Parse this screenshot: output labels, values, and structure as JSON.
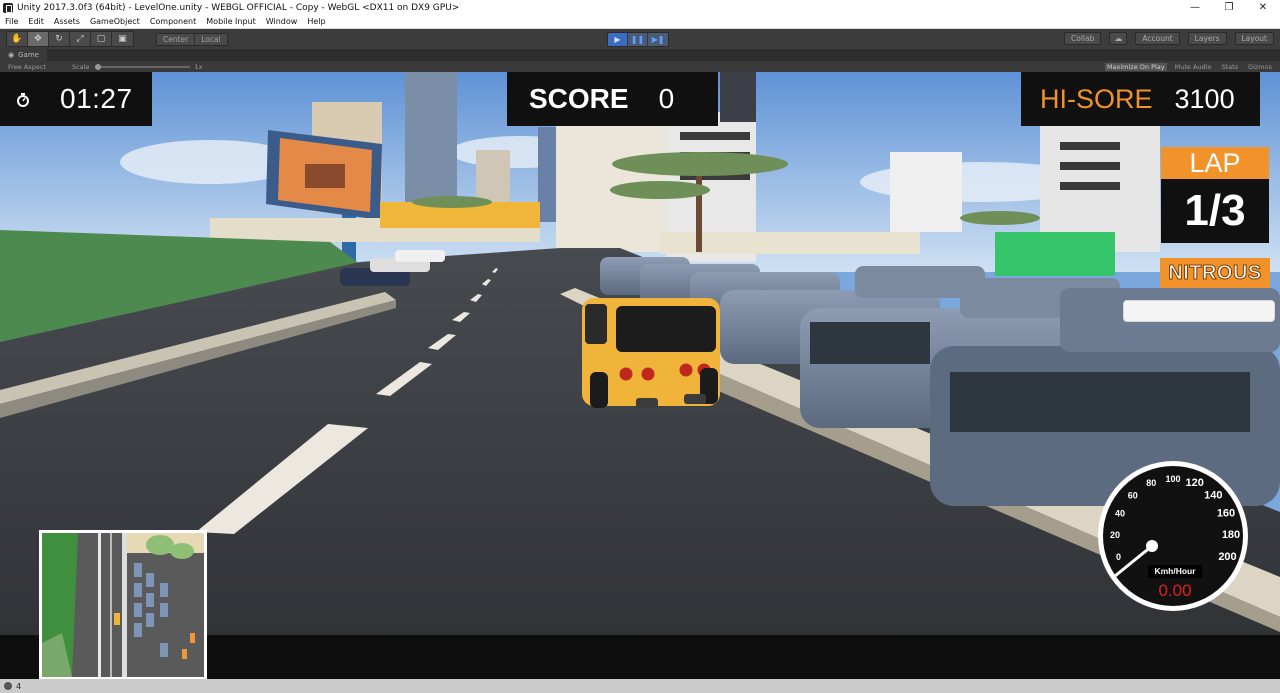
{
  "window": {
    "title": "Unity 2017.3.0f3 (64bit) - LevelOne.unity - WEBGL OFFICIAL - Copy - WebGL <DX11 on DX9 GPU>",
    "controls": [
      "minimize-icon",
      "maximize-icon",
      "close-icon"
    ]
  },
  "menu": {
    "items": [
      "File",
      "Edit",
      "Assets",
      "GameObject",
      "Component",
      "Mobile Input",
      "Window",
      "Help"
    ]
  },
  "toolbar": {
    "tools": [
      "hand-icon",
      "move-icon",
      "rotate-icon",
      "scale-icon",
      "rect-icon",
      "transform-icon"
    ],
    "pivot": "Center",
    "space": "Local",
    "play_icons": [
      "play-icon",
      "pause-icon",
      "step-icon"
    ],
    "collab": "Collab",
    "account": "Account",
    "layers": "Layers",
    "layout": "Layout"
  },
  "game_panel": {
    "tab_label": "Game",
    "aspect": "Free Aspect",
    "scale_label": "Scale",
    "scale_value": "1x",
    "options": [
      "Maximize On Play",
      "Mute Audio",
      "Stats",
      "Gizmos"
    ]
  },
  "hud": {
    "timer": "01:27",
    "score_label": "SCORE",
    "score_value": "0",
    "hiscore_label": "HI-SORE",
    "hiscore_value": "3100",
    "lap_label": "LAP",
    "lap_value": "1/3",
    "nitro_label": "NITROUS",
    "nitro_level": 1.0,
    "speed_unit": "Kmh/Hour",
    "speed_value": "0.00",
    "speedometer_ticks": [
      "0",
      "20",
      "40",
      "60",
      "80",
      "100",
      "120",
      "140",
      "160",
      "180",
      "200"
    ],
    "colors": {
      "accent": "#f2922a",
      "panel": "#101010",
      "speed_text": "#e02020"
    }
  },
  "status": {
    "text": "4"
  }
}
